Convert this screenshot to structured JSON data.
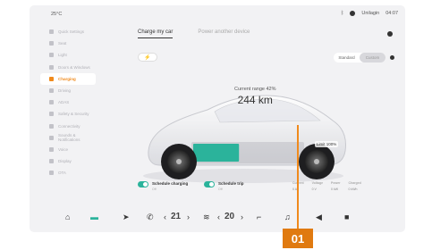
{
  "status_bar": {
    "temperature": "25°C",
    "signal": "83 km",
    "user": "Unilagin",
    "time": "04:07"
  },
  "sidebar": {
    "items": [
      {
        "label": "Quick Settings",
        "active": false
      },
      {
        "label": "Seat",
        "active": false
      },
      {
        "label": "Light",
        "active": false
      },
      {
        "label": "Doors & Windows",
        "active": false
      },
      {
        "label": "Charging",
        "active": true
      },
      {
        "label": "Driving",
        "active": false
      },
      {
        "label": "ADAS",
        "active": false
      },
      {
        "label": "Safety & Security",
        "active": false
      },
      {
        "label": "Connectivity",
        "active": false
      },
      {
        "label": "Sounds & Notifications",
        "active": false
      },
      {
        "label": "Voice",
        "active": false
      },
      {
        "label": "Display",
        "active": false
      },
      {
        "label": "OTA",
        "active": false
      }
    ]
  },
  "tabs": [
    {
      "label": "Charge my car",
      "active": true
    },
    {
      "label": "Power another device",
      "active": false
    }
  ],
  "charge_mode": {
    "options": [
      "Standard",
      "Custom"
    ],
    "selected": "Custom"
  },
  "range": {
    "label": "Current range 42%",
    "value": "244 km",
    "battery_fraction": 0.42
  },
  "limit": {
    "label": "Limit 100%"
  },
  "options": [
    {
      "label": "Schedule charging",
      "sub": "Off",
      "on": true
    },
    {
      "label": "Schedule trip",
      "sub": "Off",
      "on": true
    }
  ],
  "stats": [
    {
      "label": "Current",
      "value": "0 A"
    },
    {
      "label": "Voltage",
      "value": "0 V"
    },
    {
      "label": "Power",
      "value": "0 kW"
    },
    {
      "label": "Charged",
      "value": "0 kWh"
    }
  ],
  "dock": {
    "driver_temp": "21",
    "passenger_temp": "20"
  },
  "callout": {
    "number": "01"
  },
  "colors": {
    "accent": "#f08a1c",
    "battery": "#2bb39b",
    "callout": "#e07a10"
  }
}
